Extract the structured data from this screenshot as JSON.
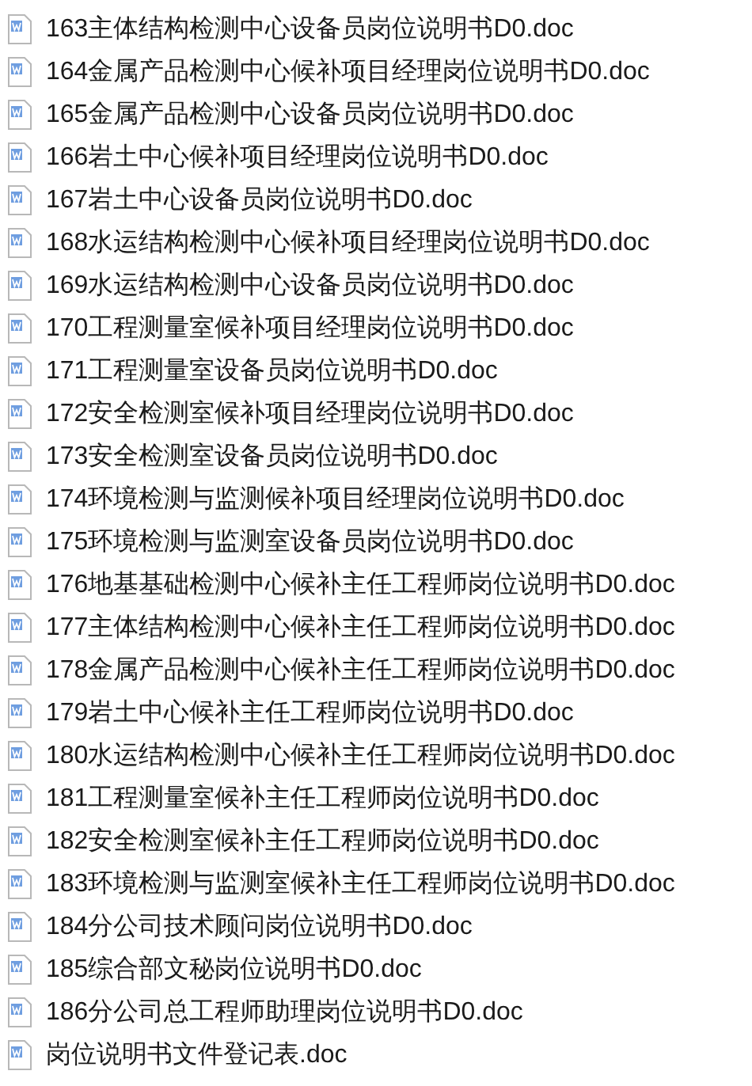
{
  "files": [
    {
      "name": "163主体结构检测中心设备员岗位说明书D0.doc"
    },
    {
      "name": "164金属产品检测中心候补项目经理岗位说明书D0.doc"
    },
    {
      "name": "165金属产品检测中心设备员岗位说明书D0.doc"
    },
    {
      "name": "166岩土中心候补项目经理岗位说明书D0.doc"
    },
    {
      "name": "167岩土中心设备员岗位说明书D0.doc"
    },
    {
      "name": "168水运结构检测中心候补项目经理岗位说明书D0.doc"
    },
    {
      "name": "169水运结构检测中心设备员岗位说明书D0.doc"
    },
    {
      "name": "170工程测量室候补项目经理岗位说明书D0.doc"
    },
    {
      "name": "171工程测量室设备员岗位说明书D0.doc"
    },
    {
      "name": "172安全检测室候补项目经理岗位说明书D0.doc"
    },
    {
      "name": "173安全检测室设备员岗位说明书D0.doc"
    },
    {
      "name": "174环境检测与监测候补项目经理岗位说明书D0.doc"
    },
    {
      "name": "175环境检测与监测室设备员岗位说明书D0.doc"
    },
    {
      "name": "176地基基础检测中心候补主任工程师岗位说明书D0.doc"
    },
    {
      "name": "177主体结构检测中心候补主任工程师岗位说明书D0.doc"
    },
    {
      "name": "178金属产品检测中心候补主任工程师岗位说明书D0.doc"
    },
    {
      "name": "179岩土中心候补主任工程师岗位说明书D0.doc"
    },
    {
      "name": "180水运结构检测中心候补主任工程师岗位说明书D0.doc"
    },
    {
      "name": "181工程测量室候补主任工程师岗位说明书D0.doc"
    },
    {
      "name": "182安全检测室候补主任工程师岗位说明书D0.doc"
    },
    {
      "name": "183环境检测与监测室候补主任工程师岗位说明书D0.doc"
    },
    {
      "name": "184分公司技术顾问岗位说明书D0.doc"
    },
    {
      "name": "185综合部文秘岗位说明书D0.doc"
    },
    {
      "name": "186分公司总工程师助理岗位说明书D0.doc"
    },
    {
      "name": "岗位说明书文件登记表.doc"
    }
  ]
}
